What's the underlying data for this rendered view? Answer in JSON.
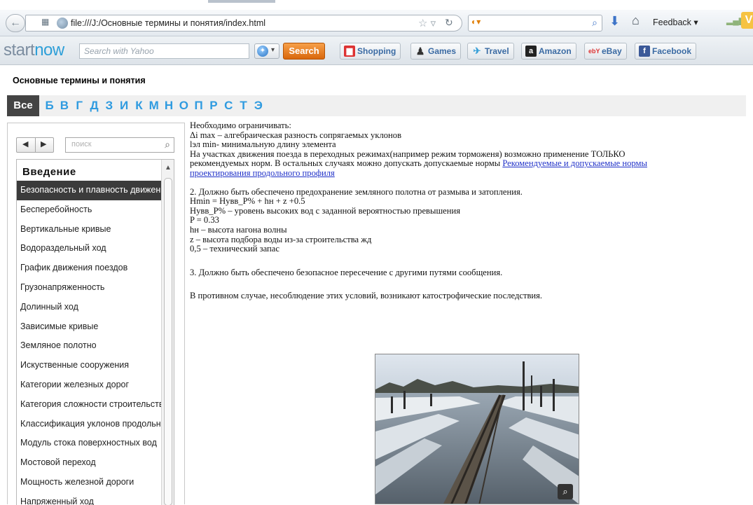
{
  "browser": {
    "url": "file:///J:/Основные термины и понятия/index.html",
    "feedback_label": "Feedback ▾"
  },
  "toolbar": {
    "brand_start": "start",
    "brand_now": "now",
    "search_placeholder": "Search with Yahoo",
    "search_button": "Search",
    "links": [
      "Shopping",
      "Games",
      "Travel",
      "Amazon",
      "eBay",
      "Facebook"
    ]
  },
  "page": {
    "title": "Основные термины и понятия",
    "alpha_all": "Все",
    "letters": [
      "Б",
      "В",
      "Г",
      "Д",
      "З",
      "И",
      "К",
      "М",
      "Н",
      "О",
      "П",
      "Р",
      "С",
      "Т",
      "Э"
    ]
  },
  "sidebar": {
    "search_placeholder": "поиск",
    "section_title": "Введение",
    "items": [
      "Безопасность и плавность движения",
      "Бесперебойность",
      "Вертикальные кривые",
      "Водораздельный ход",
      "График движения поездов",
      "Грузонапряженность",
      "Долинный ход",
      "Зависимые кривые",
      "Земляное полотно",
      "Искуственные сооружения",
      "Категории железных дорог",
      "Категория сложности строительства",
      "Классификация уклонов продольного профиля",
      "Модуль стока поверхностных вод",
      "Мостовой переход",
      "Мощность железной дороги",
      "Напряженный ход"
    ]
  },
  "content": {
    "lines1": [
      "Необходимо ограничивать:",
      "Δi max – алгебраическая разность сопрягаемых уклонов",
      "lэл min-  минимальную длину элемента",
      "На участках движения поезда в переходных режимах(например режим торможеня) возможно применение ТОЛЬКО"
    ],
    "line5_text": "рекомендуемых норм. В остальных случаях можно допускать допускаемые нормы ",
    "link1": "Рекомендуемые и допускаемые нормы",
    "link2": "проектирования продольного профиля",
    "lines2": [
      "2. Должно быть обеспечено предохранение земляного полотна от размыва и затопления.",
      "Hmin = Hувв_P% + hн + z +0.5",
      "Hувв_P% – уровень высоких вод с заданной вероятностью превышения",
      "P = 0.33",
      "hн – высота нагона волны",
      "z – высота подбора воды из-за строительства жд",
      "0,5 – технический запас"
    ],
    "line3": "3. Должно быть обеспечено безопасное пересечение с другими путями сообщения.",
    "line4": "В противном случае, несоблюдение этих условий, возникают катострофические последствия."
  }
}
